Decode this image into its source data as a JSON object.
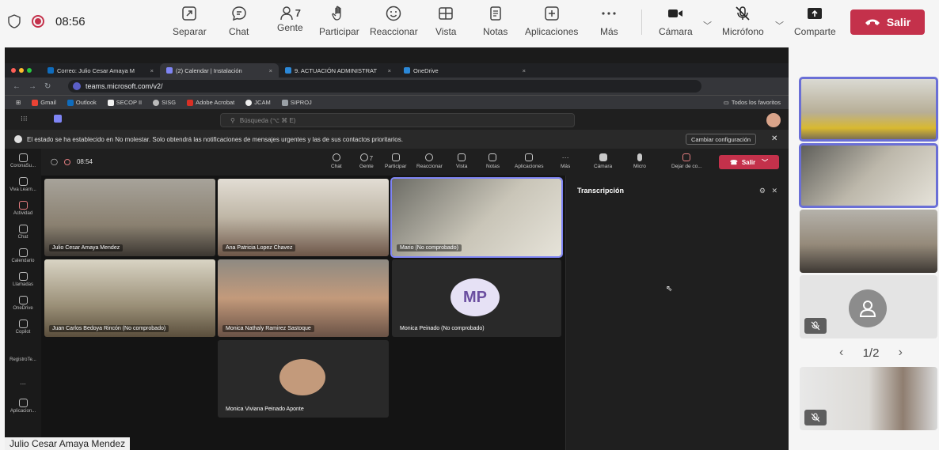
{
  "toolbar": {
    "time": "08:56",
    "separate": "Separar",
    "chat": "Chat",
    "people": "Gente",
    "people_count": "7",
    "participate": "Participar",
    "react": "Reaccionar",
    "view": "Vista",
    "notes": "Notas",
    "apps": "Aplicaciones",
    "more": "Más",
    "camera": "Cámara",
    "mic": "Micrófono",
    "share": "Comparte",
    "leave": "Salir"
  },
  "shared": {
    "tabs": [
      "Correo: Julio Cesar Amaya M",
      "(2) Calendar | Instalación",
      "9. ACTUACIÓN ADMINISTRAT",
      "OneDrive"
    ],
    "url": "teams.microsoft.com/v2/",
    "bookmarks": [
      "Gmail",
      "Outlook",
      "SECOP II",
      "SISG",
      "Adobe Acrobat",
      "JCAM",
      "SIPROJ"
    ],
    "bookmarks_right": "Todos los favoritos",
    "search_placeholder": "Búsqueda (⌥ ⌘ E)",
    "dnd_message": "El estado se ha establecido en No molestar. Solo obtendrá las notificaciones de mensajes urgentes y las de sus contactos prioritarios.",
    "dnd_button": "Cambiar configuración",
    "rail": [
      "CoronaSu...",
      "Viva Learn...",
      "Actividad",
      "Chat",
      "Calendario",
      "Llamadas",
      "OneDrive",
      "Copilot",
      "RegistroTe...",
      "...",
      "Aplicacion..."
    ],
    "inner_time": "08:54",
    "inner_toolbar": {
      "chat": "Chat",
      "people": "Gente",
      "people_count": "7",
      "participate": "Participar",
      "react": "Reaccionar",
      "view": "Vista",
      "notes": "Notas",
      "apps": "Aplicaciones",
      "more": "Más",
      "camera": "Cámara",
      "mic": "Micro",
      "leave_label": "Dejar de co...",
      "leave": "Salir"
    },
    "participants": [
      "Julio Cesar Amaya Mendez",
      "Ana Patricia Lopez Chavez",
      "Mario (No comprobado)",
      "Juan Carlos Bedoya Rincón (No comprobado)",
      "Monica Nathaly Ramirez Sastoque",
      "Monica Peinado (No comprobado)",
      "Monica Viviana Peinado Aponte"
    ],
    "mp_initials": "MP",
    "transcript_title": "Transcripción",
    "presenter": "Julio Cesar Amaya Mendez"
  },
  "gallery": {
    "pager": "1/2"
  },
  "colors": {
    "accent": "#5b5fc7",
    "leave": "#c4314b",
    "speaking_outline": "#6a6fd6"
  }
}
